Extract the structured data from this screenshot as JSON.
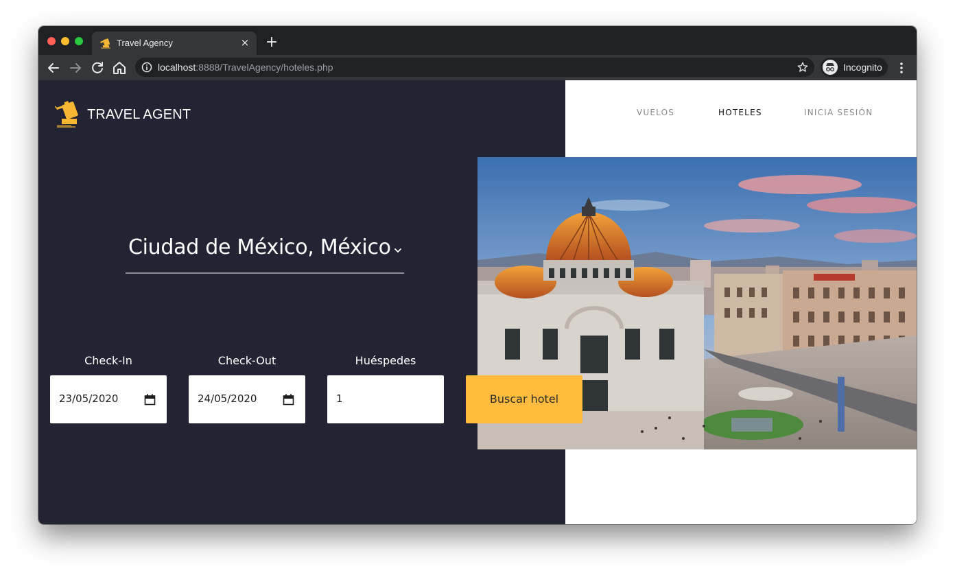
{
  "browser": {
    "tab_title": "Travel Agency",
    "close_glyph": "×",
    "newtab_glyph": "+",
    "url_host": "localhost",
    "url_path": ":8888/TravelAgency/hoteles.php",
    "profile_label": "Incognito"
  },
  "site": {
    "brand_name": "TRAVEL AGENT",
    "nav": {
      "flights": "VUELOS",
      "hotels": "HOTELES",
      "login": "INICIA SESIÓN"
    },
    "destination": "Ciudad de México, México",
    "form": {
      "checkin_label": "Check-In",
      "checkin_value": "23/05/2020",
      "checkout_label": "Check-Out",
      "checkout_value": "24/05/2020",
      "guests_label": "Huéspedes",
      "guests_value": "1",
      "search_button": "Buscar hotel"
    }
  },
  "colors": {
    "left_panel": "#232433",
    "accent": "#ffbc3f",
    "chrome_dark": "#202124",
    "chrome_toolbar": "#35363a"
  },
  "icons": [
    "back-arrow-icon",
    "forward-arrow-icon",
    "reload-icon",
    "home-icon",
    "info-icon",
    "star-icon",
    "incognito-icon",
    "kebab-menu-icon",
    "calendar-icon",
    "chevron-down-icon"
  ]
}
